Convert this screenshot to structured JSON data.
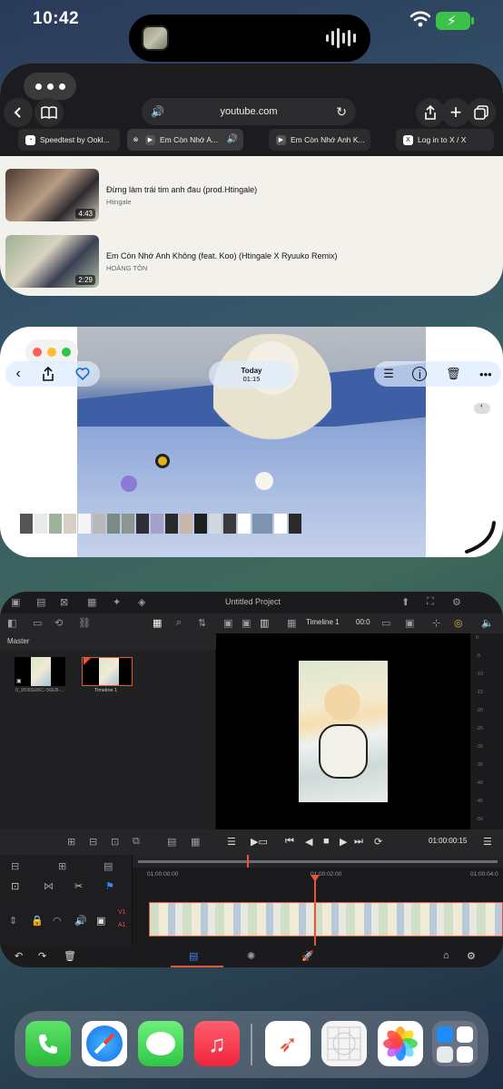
{
  "status": {
    "time": "10:42"
  },
  "safari": {
    "url": "youtube.com",
    "tabs": [
      {
        "label": "Speedtest by Ookl...",
        "favicon": "speedtest"
      },
      {
        "label": "Em Còn Nhớ A...",
        "favicon": "youtube"
      },
      {
        "label": "Em Còn Nhớ Anh K...",
        "favicon": "youtube"
      },
      {
        "label": "Log in to X / X",
        "favicon": "x"
      }
    ],
    "videos": [
      {
        "title": "Đừng làm trái tim anh đau (prod.Htingale)",
        "channel": "Htingale",
        "duration": "4:43"
      },
      {
        "title": "Em Còn Nhớ Anh Không (feat. Koo) (Htingale X Ryuuko Remix)",
        "channel": "HOÀNG TÔN",
        "duration": "2:29"
      }
    ]
  },
  "photos": {
    "date_title": "Today",
    "date_time": "01:15"
  },
  "resolve": {
    "project_title": "Untitled Project",
    "timeline_selector": "Timeline 1",
    "timecode_short": "00:0",
    "bin_label": "Master",
    "clips": [
      {
        "name": "0_9590E86C-56EB-..."
      },
      {
        "name": "Timeline 1"
      }
    ],
    "playback_timecode": "01:00:00:15",
    "ruler": [
      "01:00:00:00",
      "01:00:02:00",
      "01:00:04:0"
    ],
    "track_labels": [
      "V1",
      "A1"
    ],
    "meter_ticks": [
      "0",
      "-5",
      "-10",
      "-15",
      "-20",
      "-25",
      "-30",
      "-35",
      "-40",
      "-45",
      "-50"
    ]
  },
  "dock": {
    "apps": [
      "phone-icon",
      "safari-icon",
      "messages-icon",
      "music-icon",
      "swift-playgrounds-icon",
      "grid-app-icon",
      "photos-icon",
      "app-library-icon"
    ]
  }
}
